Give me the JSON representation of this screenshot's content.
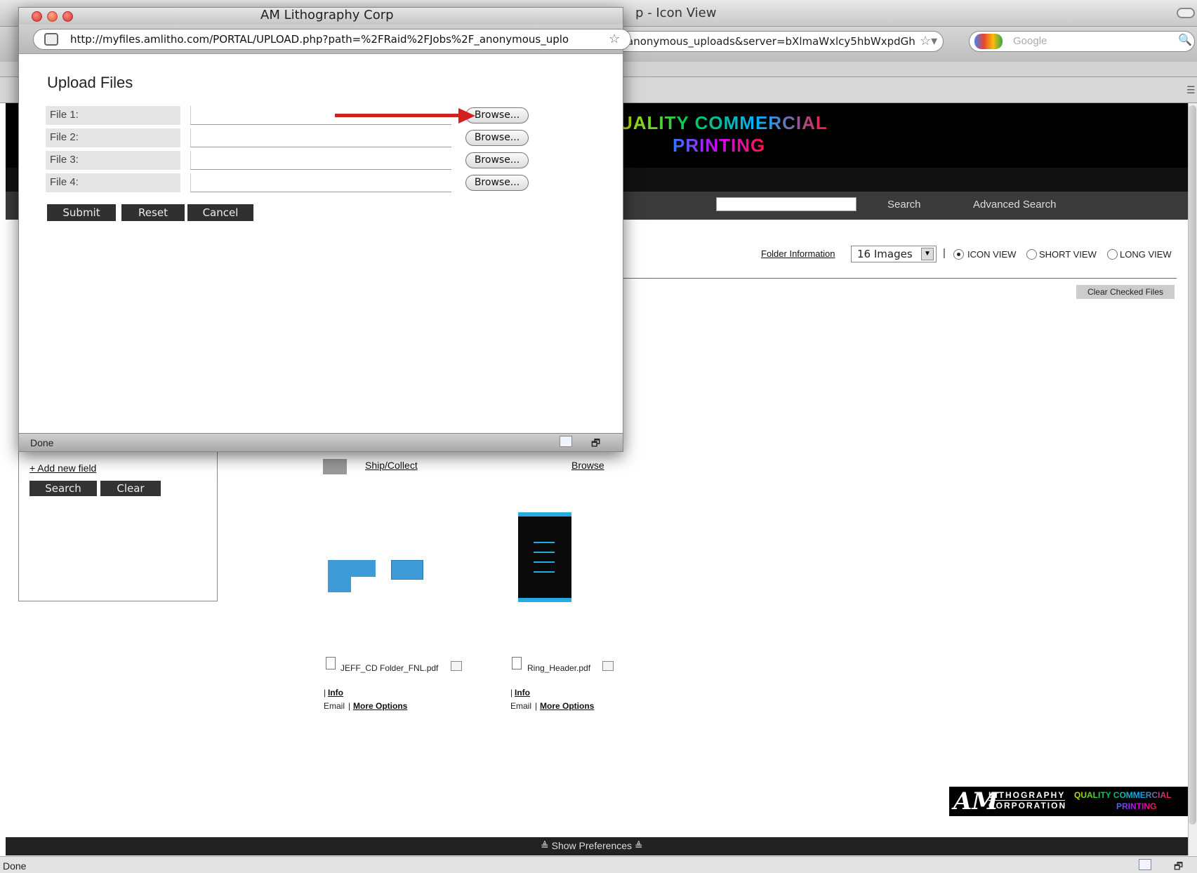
{
  "background_window": {
    "title": "p - Icon View",
    "url_fragment": "anonymous_uploads&server=bXlmaWxlcy5hbWxpdGh",
    "search_placeholder": "Google",
    "site_logo_line1": "UALITY COMMERCIAL",
    "site_logo_line2": "PRINTING",
    "nav": {
      "search_label": "Search",
      "advanced_search_label": "Advanced Search"
    },
    "view_bar": {
      "folder_information": "Folder Information",
      "images_select": "16 Images",
      "separator": "|",
      "icon_view": "ICON VIEW",
      "short_view": "SHORT VIEW",
      "long_view": "LONG VIEW",
      "selected_view": "icon"
    },
    "clear_checked": "Clear Checked Files",
    "sidebar": {
      "add_new_field": "+ Add new field",
      "search_button": "Search",
      "clear_button": "Clear"
    },
    "folder_item": {
      "name": "Ship/Collect",
      "browse": "Browse"
    },
    "files": [
      {
        "name": "JEFF_CD Folder_FNL.pdf",
        "pipe": "|",
        "info": "Info",
        "email": "Email",
        "more_options": "More Options"
      },
      {
        "name": "Ring_Header.pdf",
        "pipe": "|",
        "info": "Info",
        "email": "Email",
        "more_options": "More Options"
      }
    ],
    "footer_logo": {
      "am": "AM",
      "litho": "LITHOGRAPHY",
      "corp": "CORPORATION",
      "q1": "QUALITY COMMERCIAL",
      "q2": "PRINTING"
    },
    "show_preferences": "≜ Show Preferences ≜",
    "status": "Done"
  },
  "popup": {
    "title": "AM Lithography Corp",
    "url": "http://myfiles.amlitho.com/PORTAL/UPLOAD.php?path=%2FRaid%2FJobs%2F_anonymous_uplo",
    "heading": "Upload Files",
    "file_rows": [
      {
        "label": "File 1:",
        "value": "",
        "browse": "Browse..."
      },
      {
        "label": "File 2:",
        "value": "",
        "browse": "Browse..."
      },
      {
        "label": "File 3:",
        "value": "",
        "browse": "Browse..."
      },
      {
        "label": "File 4:",
        "value": "",
        "browse": "Browse..."
      }
    ],
    "buttons": {
      "submit": "Submit",
      "reset": "Reset",
      "cancel": "Cancel"
    },
    "status": "Done"
  },
  "annotation": {
    "arrow_color": "#d21f1f",
    "points_to": "File 1 Browse button"
  },
  "colors": {
    "header_bg": "#000000",
    "nav_bg": "#3a3a3a",
    "button_bg": "#303030"
  }
}
